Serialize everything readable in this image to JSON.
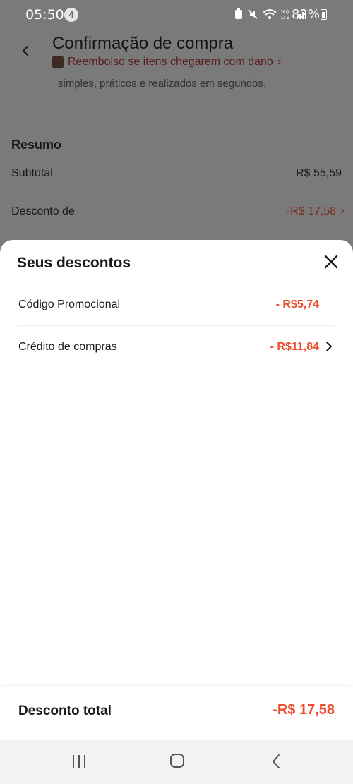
{
  "status_bar": {
    "time": "05:50",
    "notification_count": "4",
    "battery_percent": "82%",
    "icons": [
      "battery-saver-icon",
      "mute-icon",
      "wifi-icon",
      "volte-icon",
      "signal-icon"
    ]
  },
  "header": {
    "title": "Confirmação de compra",
    "refund_text": "Reembolso se itens chegarem com dano",
    "refund_chevron": "›",
    "subtitle": "simples, práticos e realizados em segundos."
  },
  "summary": {
    "title": "Resumo",
    "subtotal_label": "Subtotal",
    "subtotal_value": "R$ 55,59",
    "discount_label": "Desconto de",
    "discount_value": "-R$ 17,58",
    "discount_chevron": "›"
  },
  "sheet": {
    "title": "Seus descontos",
    "items": [
      {
        "label": "Código Promocional",
        "value": "- R$5,74"
      },
      {
        "label": "Crédito de compras",
        "value": "- R$11,84"
      }
    ],
    "total_label": "Desconto total",
    "total_value": "-R$ 17,58"
  },
  "colors": {
    "accent": "#ee4a2e",
    "overlay": "#7a7a7a",
    "sheet_bg": "#ffffff",
    "navbar_bg": "#f2f2f2"
  }
}
